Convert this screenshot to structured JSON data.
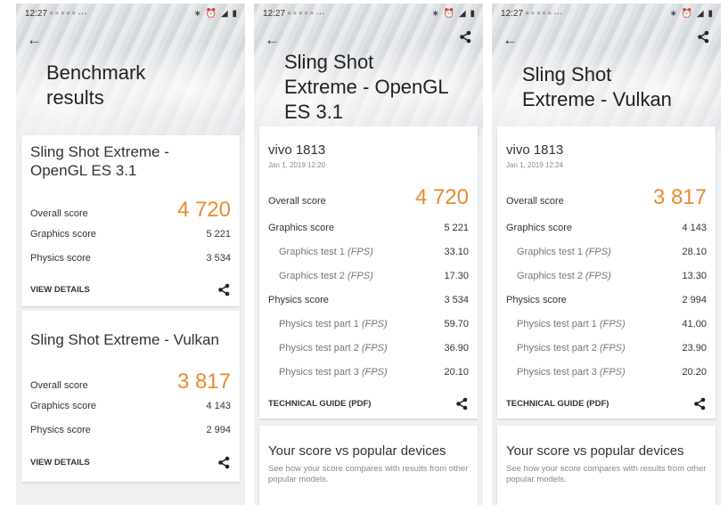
{
  "status": {
    "time": "12:27",
    "icons": "▫ ▫ ▫ ▫ ▫ ···",
    "right": "∗ ⏰ ◢ ▮"
  },
  "screen1": {
    "title_line1": "Benchmark",
    "title_line2": "results",
    "card1": {
      "title": "Sling Shot Extreme - OpenGL ES 3.1",
      "overall_label": "Overall score",
      "overall": "4 720",
      "graphics_label": "Graphics score",
      "graphics": "5 221",
      "physics_label": "Physics score",
      "physics": "3 534",
      "details": "VIEW DETAILS"
    },
    "card2": {
      "title": "Sling Shot Extreme - Vulkan",
      "overall_label": "Overall score",
      "overall": "3 817",
      "graphics_label": "Graphics score",
      "graphics": "4 143",
      "physics_label": "Physics score",
      "physics": "2 994",
      "details": "VIEW DETAILS"
    }
  },
  "screen2": {
    "title_line1": "Sling Shot",
    "title_line2": "Extreme - OpenGL",
    "title_line3": "ES 3.1",
    "device": "vivo 1813",
    "date": "Jan 1, 2019 12:20",
    "overall_label": "Overall score",
    "overall": "4 720",
    "graphics_label": "Graphics score",
    "graphics": "5 221",
    "gt1_label": "Graphics test 1",
    "gt1": "33.10",
    "gt2_label": "Graphics test 2",
    "gt2": "17.30",
    "physics_label": "Physics score",
    "physics": "3 534",
    "pt1_label": "Physics test part 1",
    "pt1": "59.70",
    "pt2_label": "Physics test part 2",
    "pt2": "36.90",
    "pt3_label": "Physics test part 3",
    "pt3": "20.10",
    "fps": "(FPS)",
    "guide": "TECHNICAL GUIDE (PDF)",
    "pop_title": "Your score vs popular devices",
    "pop_text": "See how your score compares with results from other popular models."
  },
  "screen3": {
    "title_line1": "Sling Shot",
    "title_line2": "Extreme - Vulkan",
    "device": "vivo 1813",
    "date": "Jan 1, 2019 12:24",
    "overall_label": "Overall score",
    "overall": "3 817",
    "graphics_label": "Graphics score",
    "graphics": "4 143",
    "gt1_label": "Graphics test 1",
    "gt1": "28.10",
    "gt2_label": "Graphics test 2",
    "gt2": "13.30",
    "physics_label": "Physics score",
    "physics": "2 994",
    "pt1_label": "Physics test part 1",
    "pt1": "41.00",
    "pt2_label": "Physics test part 2",
    "pt2": "23.90",
    "pt3_label": "Physics test part 3",
    "pt3": "20.20",
    "fps": "(FPS)",
    "guide": "TECHNICAL GUIDE (PDF)",
    "pop_title": "Your score vs popular devices",
    "pop_text": "See how your score compares with results from other popular models."
  },
  "icons": {
    "back": "arrow-left-icon",
    "share": "share-icon"
  },
  "colors": {
    "accent": "#e98a2f",
    "background": "#eef0f2"
  }
}
